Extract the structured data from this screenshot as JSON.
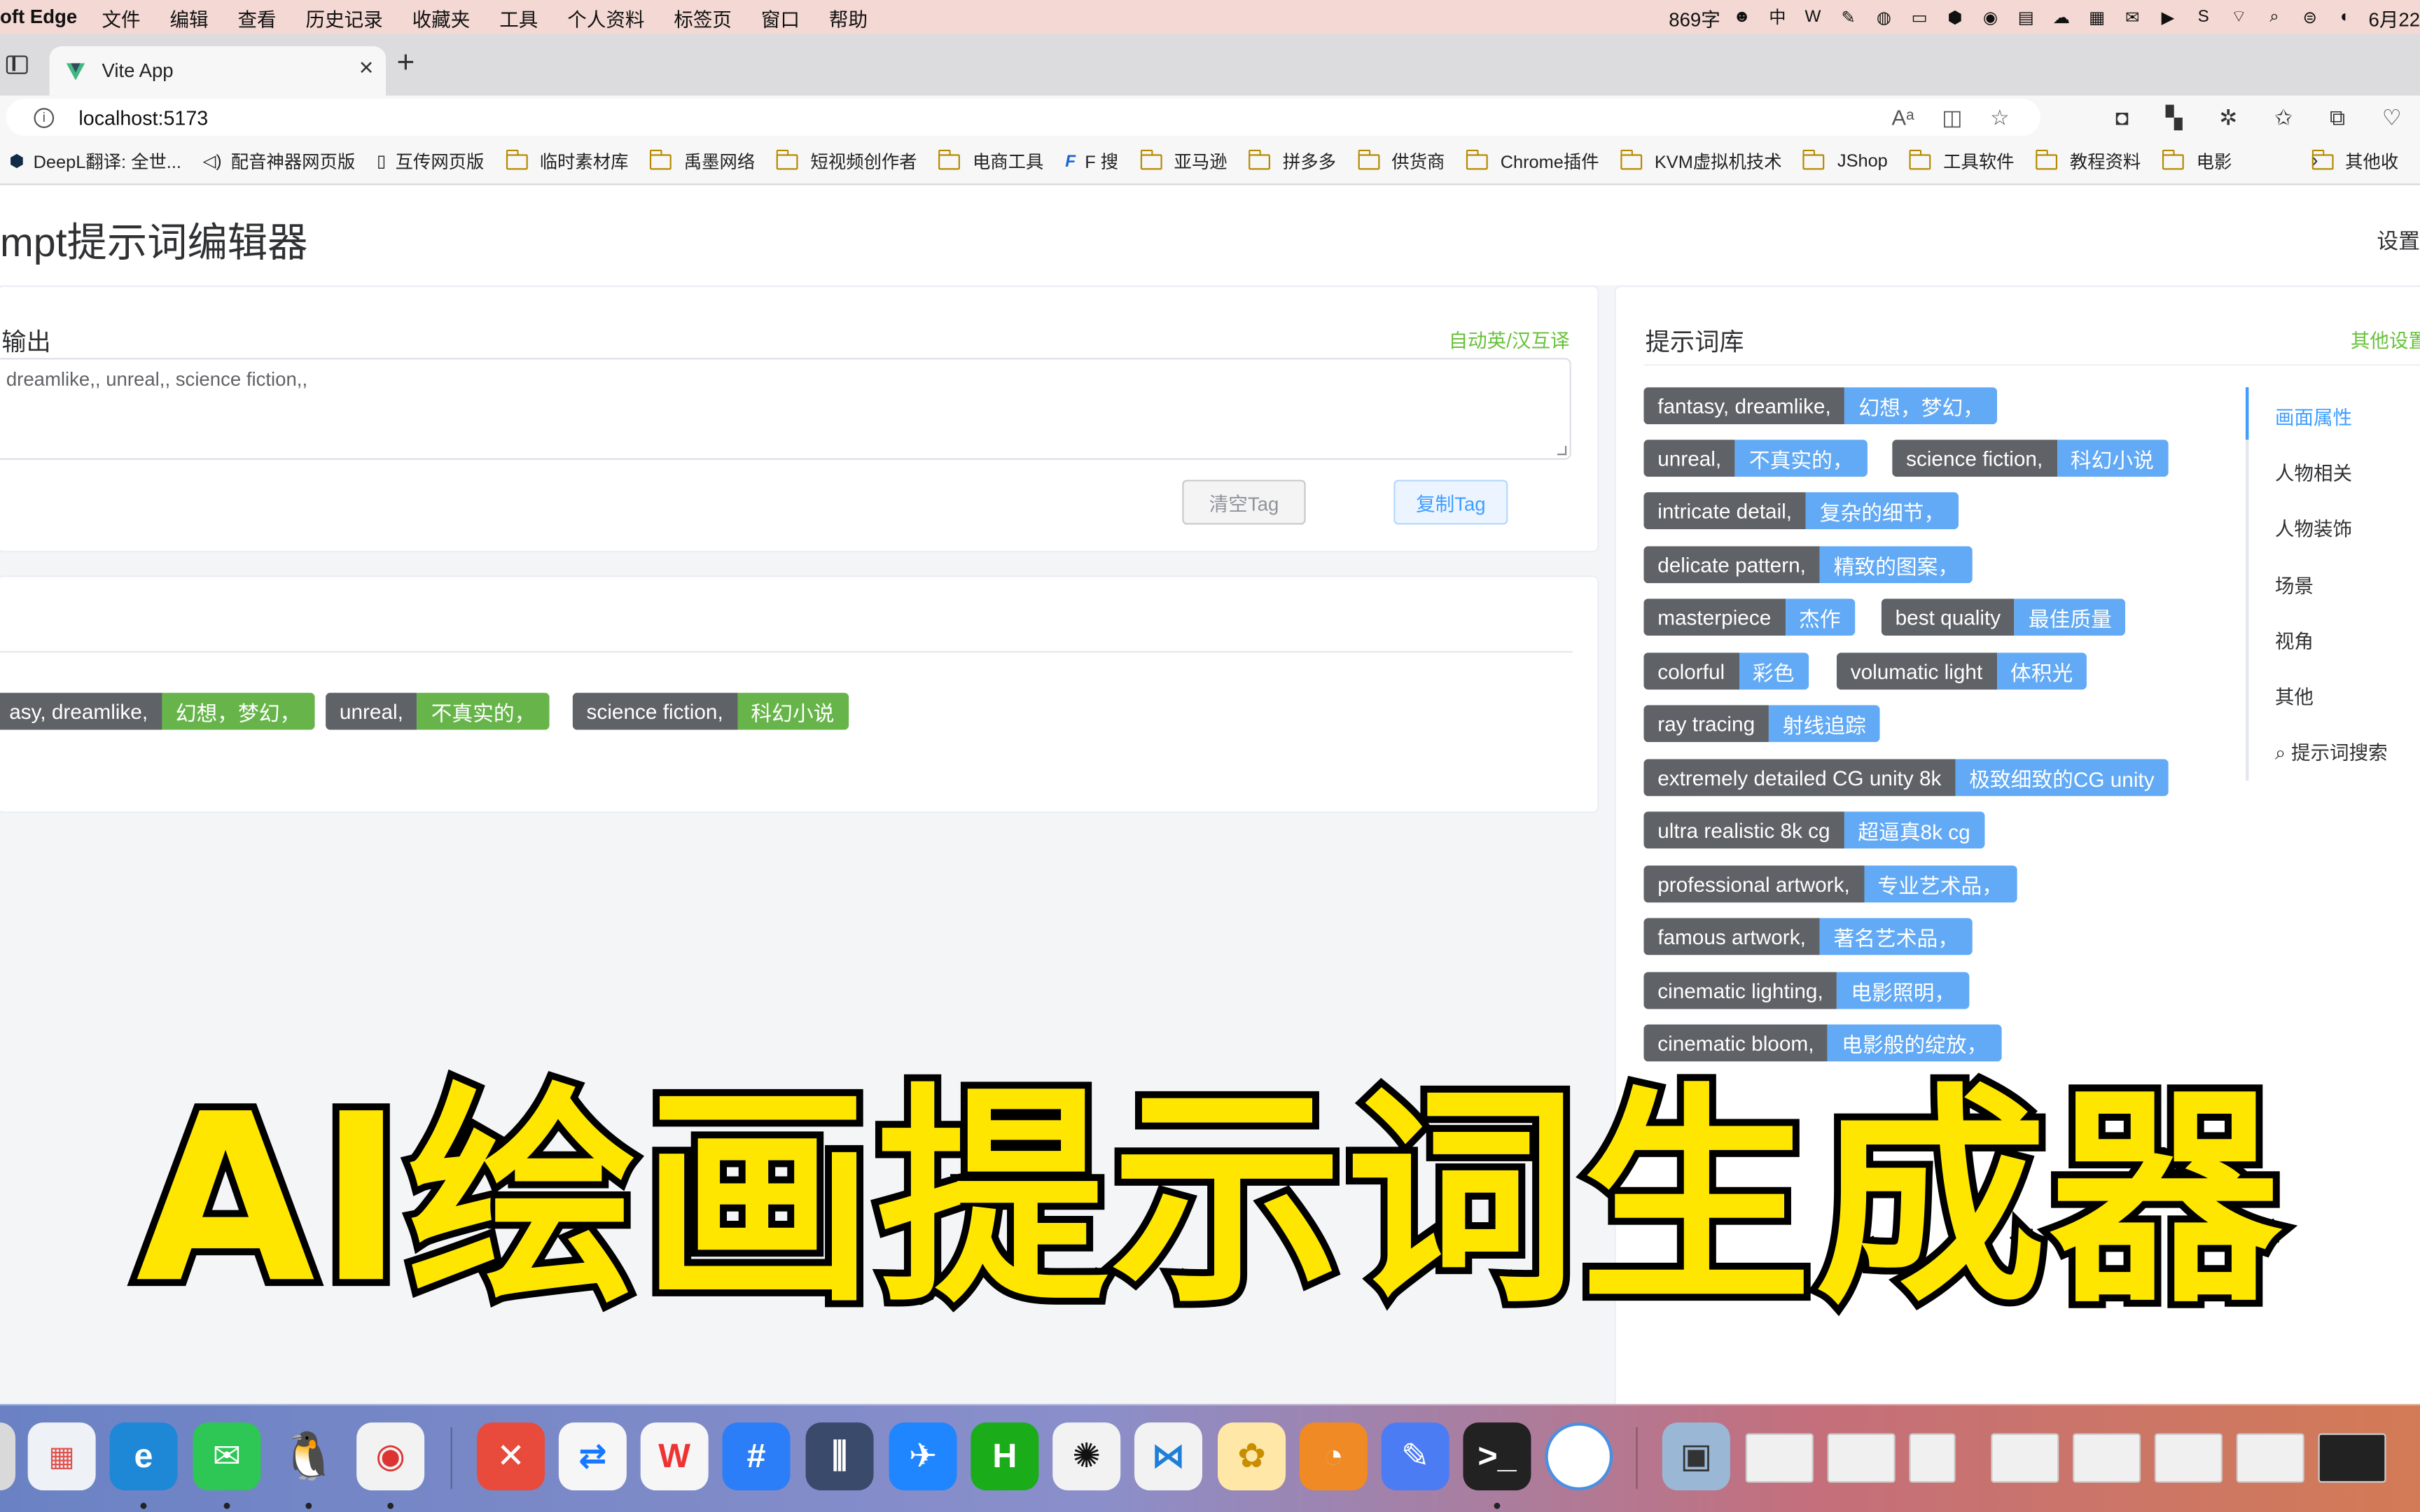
{
  "menubar": {
    "app_name": "oft Edge",
    "menus": [
      "文件",
      "编辑",
      "查看",
      "历史记录",
      "收藏夹",
      "工具",
      "个人资料",
      "标签页",
      "窗口",
      "帮助"
    ],
    "word_count": "869字",
    "date": "6月22"
  },
  "browser": {
    "tab_title": "Vite App",
    "url": "localhost:5173",
    "bookmarks": [
      {
        "label": "DeepL翻译: 全世...",
        "icon": "deepl-icon"
      },
      {
        "label": "配音神器网页版",
        "icon": "speaker-icon"
      },
      {
        "label": "互传网页版",
        "icon": "page-icon"
      },
      {
        "label": "临时素材库",
        "icon": "folder-icon"
      },
      {
        "label": "禹墨网络",
        "icon": "folder-icon"
      },
      {
        "label": "短视频创作者",
        "icon": "folder-icon"
      },
      {
        "label": "电商工具",
        "icon": "folder-icon"
      },
      {
        "label": "F 搜",
        "icon": "f-icon"
      },
      {
        "label": "亚马逊",
        "icon": "folder-icon"
      },
      {
        "label": "拼多多",
        "icon": "folder-icon"
      },
      {
        "label": "供货商",
        "icon": "folder-icon"
      },
      {
        "label": "Chrome插件",
        "icon": "folder-icon"
      },
      {
        "label": "KVM虚拟机技术",
        "icon": "folder-icon"
      },
      {
        "label": "JShop",
        "icon": "folder-icon"
      },
      {
        "label": "工具软件",
        "icon": "folder-icon"
      },
      {
        "label": "教程资料",
        "icon": "folder-icon"
      },
      {
        "label": "电影",
        "icon": "folder-icon"
      }
    ],
    "other_bookmarks": "其他收"
  },
  "page": {
    "title": "mpt提示词编辑器",
    "settings_link": "设置",
    "output": {
      "label": "输出",
      "translate_hint": "自动英/汉互译",
      "text": "dreamlike,, unreal,, science fiction,,",
      "clear_button": "清空Tag",
      "copy_button": "复制Tag"
    },
    "selected_tags": [
      {
        "en": "asy, dreamlike,",
        "zh": "幻想，梦幻，"
      },
      {
        "en": "unreal,",
        "zh": "不真实的，"
      },
      {
        "en": "science fiction,",
        "zh": "科幻小说"
      }
    ],
    "library": {
      "label": "提示词库",
      "other_settings": "其他设置",
      "tags": [
        {
          "en": "fantasy, dreamlike,",
          "zh": "幻想，梦幻，"
        },
        {
          "en": "unreal,",
          "zh": "不真实的，"
        },
        {
          "en": "science fiction,",
          "zh": "科幻小说"
        },
        {
          "en": "intricate detail,",
          "zh": "复杂的细节，"
        },
        {
          "en": "delicate pattern,",
          "zh": "精致的图案，"
        },
        {
          "en": "masterpiece",
          "zh": "杰作"
        },
        {
          "en": "best quality",
          "zh": "最佳质量"
        },
        {
          "en": "colorful",
          "zh": "彩色"
        },
        {
          "en": "volumatic light",
          "zh": "体积光"
        },
        {
          "en": "ray tracing",
          "zh": "射线追踪"
        },
        {
          "en": "extremely detailed CG unity 8k",
          "zh": "极致细致的CG unity"
        },
        {
          "en": "ultra realistic 8k cg",
          "zh": "超逼真8k cg"
        },
        {
          "en": "professional artwork,",
          "zh": "专业艺术品，"
        },
        {
          "en": "famous artwork,",
          "zh": "著名艺术品，"
        },
        {
          "en": "cinematic lighting,",
          "zh": "电影照明，"
        },
        {
          "en": "cinematic bloom,",
          "zh": "电影般的绽放，"
        }
      ]
    },
    "categories": [
      "画面属性",
      "人物相关",
      "人物装饰",
      "场景",
      "视角",
      "其他",
      "提示词搜索"
    ],
    "active_category": "画面属性"
  },
  "caption": "AI绘画提示词生成器",
  "colors": {
    "accent_blue": "#409eff",
    "tag_blue": "#62aaf5",
    "tag_green": "#67b54a",
    "tag_dark": "#5f6267",
    "success_green": "#67c23a",
    "caption_yellow": "#ffe600"
  }
}
